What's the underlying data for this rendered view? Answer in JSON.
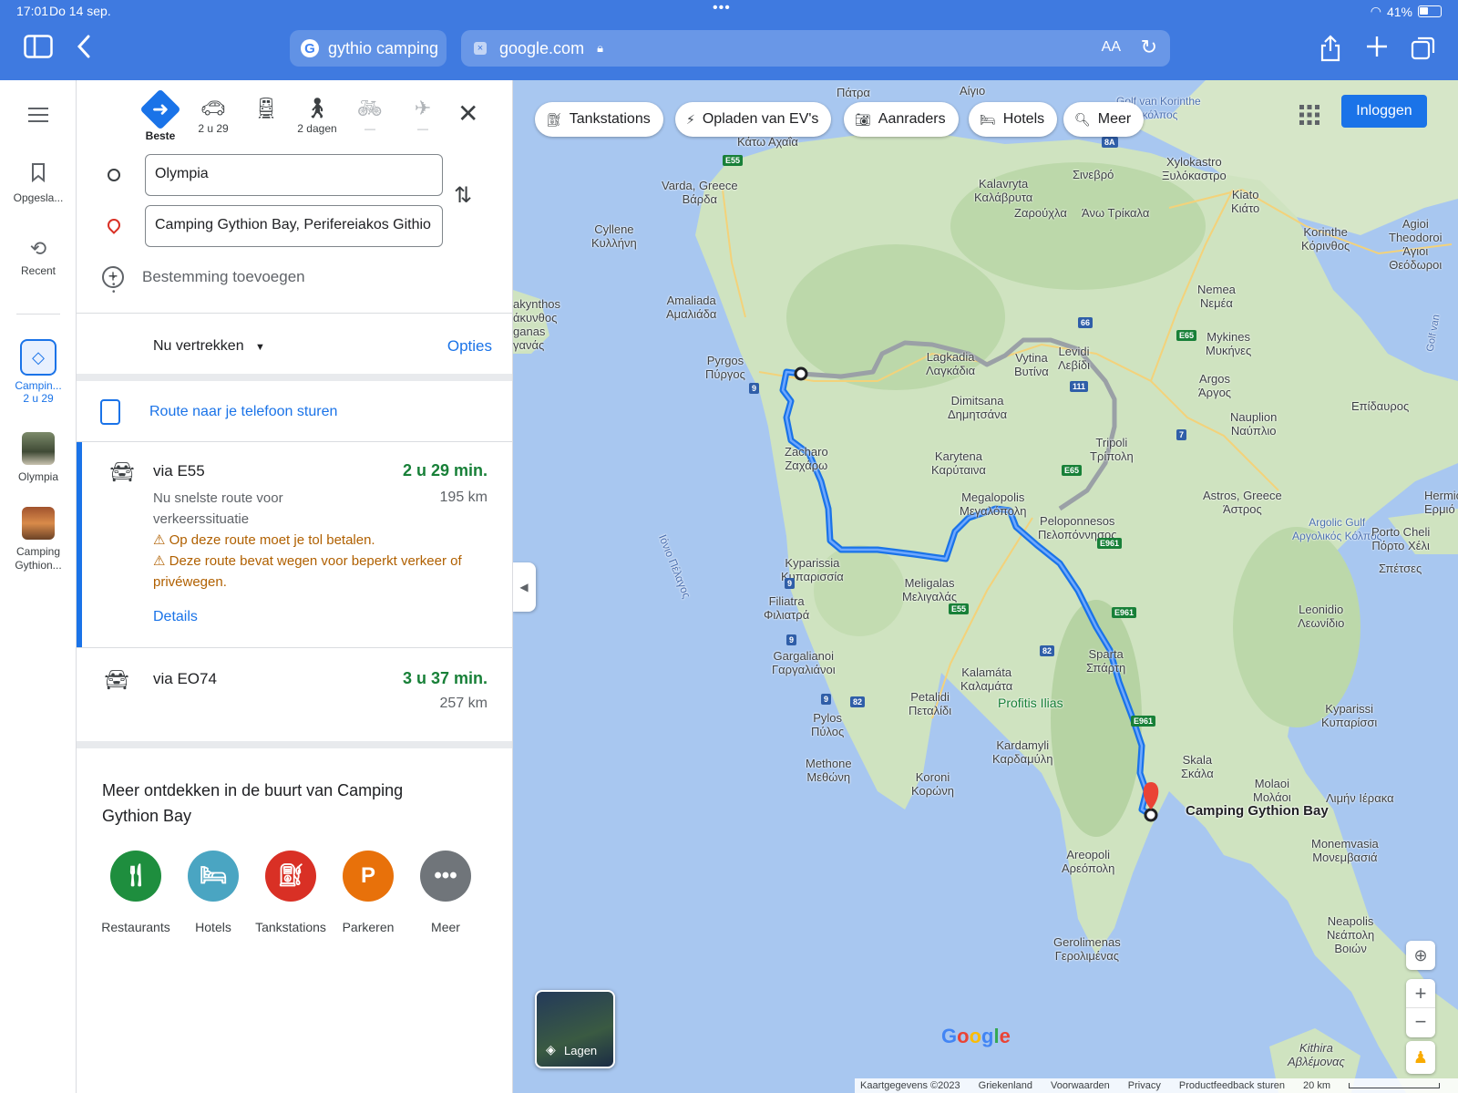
{
  "status_bar": {
    "time": "17:01",
    "date": "Do 14 sep.",
    "battery": "41%"
  },
  "browser": {
    "tab_title": "gythio camping",
    "url": "google.com",
    "text_size": "AA"
  },
  "rail": {
    "saved": "Opgesla...",
    "recent": "Recent",
    "route_item": {
      "name": "Campin...",
      "duration": "2 u 29"
    },
    "olympia": "Olympia",
    "camping": "Camping Gythion..."
  },
  "modes": [
    {
      "label": "Beste"
    },
    {
      "label": "2 u 29"
    },
    {
      "label": ""
    },
    {
      "label": "2 dagen"
    },
    {
      "label": "—"
    },
    {
      "label": "—"
    }
  ],
  "directions": {
    "origin": "Olympia",
    "destination": "Camping Gythion Bay, Perifereiakos Githio",
    "add_destination": "Bestemming toevoegen",
    "depart": "Nu vertrekken",
    "options": "Opties",
    "send_to_phone": "Route naar je telefoon sturen"
  },
  "routes": [
    {
      "via": "via E55",
      "time": "2 u 29 min.",
      "distance": "195 km",
      "description": "Nu snelste route voor verkeerssituatie",
      "warnings": [
        "Op deze route moet je tol betalen.",
        "Deze route bevat wegen voor beperkt verkeer of privéwegen."
      ],
      "details": "Details"
    },
    {
      "via": "via EO74",
      "time": "3 u 37 min.",
      "distance": "257 km"
    }
  ],
  "explore": {
    "title": "Meer ontdekken in de buurt van Camping Gythion Bay",
    "categories": [
      {
        "label": "Restaurants",
        "color": "#1e8e3e"
      },
      {
        "label": "Hotels",
        "color": "#4aa5c2"
      },
      {
        "label": "Tankstations",
        "color": "#d93025"
      },
      {
        "label": "Parkeren",
        "color": "#e8710a"
      },
      {
        "label": "Meer",
        "color": "#70757a"
      }
    ]
  },
  "map": {
    "chips": [
      "Tankstations",
      "Opladen van EV's",
      "Aanraders",
      "Hotels",
      "Meer"
    ],
    "login": "Inloggen",
    "layers": "Lagen",
    "destination_label": "Camping Gythion Bay",
    "places": {
      "pyrgos": "Pyrgos\nΠύργος",
      "zacharo": "Zacharo\nΖαχάρω",
      "kyparissia": "Kyparissia\nΚυπαρισσία",
      "filiatra": "Filiatra\nΦιλιατρά",
      "gargalianoi": "Gargalianoi\nΓαργαλιάνοι",
      "pylos": "Pylos\nΠύλος",
      "methone": "Methone\nΜεθώνη",
      "koroni": "Koroni\nΚορώνη",
      "petalidi": "Petalidi\nΠεταλίδι",
      "kalamata": "Kalamáta\nΚαλαμάτα",
      "meligalas": "Meligalas\nΜελιγαλάς",
      "megalopolis": "Megalopolis\nΜεγαλόπολη",
      "karytena": "Karytena\nΚαρύταινα",
      "dimitsana": "Dimitsana\nΔημητσάνα",
      "lagkadia": "Lagkadia\nΛαγκάδια",
      "vytina": "Vytina\nΒυτίνα",
      "levidi": "Levidi\nΛεβίδι",
      "tripoli": "Tripoli\nΤρίπολη",
      "peloponnesos": "Peloponnesos\nΠελοπόννησος",
      "sparta": "Sparta\nΣπάρτη",
      "profitis": "Profitis Ilias",
      "kardamyli": "Kardamyli\nΚαρδαμύλη",
      "areopoli": "Areopoli\nΑρεόπολη",
      "gerolimenas": "Gerolimenas\nΓερολιμένας",
      "skala": "Skala\nΣκάλα",
      "molaoi": "Molaoi\nΜολάοι",
      "limin": "Λιμήν Ιέρακα",
      "monemvasia": "Monemvasia\nΜονεμβασιά",
      "neapolis": "Neapolis\nΝεάπολη\nΒοιών",
      "kiparissi": "Kyparissi\nΚυπαρίσσι",
      "leonidio": "Leonidio\nΛεωνίδιο",
      "astros": "Astros, Greece\nΆστρος",
      "argos": "Argos\nΆργος",
      "nafplio": "Nauplion\nΝαύπλιο",
      "epidavros": "Επίδαυρος",
      "mykines": "Mykines\nΜυκήνες",
      "nemea": "Nemea\nΝεμέα",
      "korinthe": "Korinthe\nΚόρινθος",
      "agioi": "Agioi\nTheodoroi\nΆγιοι\nΘεόδωροι",
      "kiato": "Kiato\nΚιάτο",
      "xylokastro": "Xylokastro\nΞυλόκαστρο",
      "sinevro": "Σινεβρό",
      "zarouchla": "Ζαρούχλα",
      "ano_trikala": "Άνω Τρίκαλα",
      "kalavryta": "Kalavryta\nΚαλάβρυτα",
      "varda": "Varda, Greece\nΒάρδα",
      "cyllene": "Cyllene\nΚυλλήνη",
      "amaliada": "Amaliada\nΑμαλιάδα",
      "zakynthos": "akynthos\nάκυνθος\nganas\nγανάς",
      "kato_achaia": "Κάτω Αχαΐα",
      "aigio": "Αίγιο",
      "patra": "Πάτρα",
      "golf_korinthe": "Golf van Korinthe\nακός κόλπος",
      "argolic": "Argolic Gulf\nΑργολικός Κόλπος",
      "porto_cheli": "Porto Cheli\nΠόρτο Χέλι",
      "spetses": "Σπέτσες",
      "hermi": "Hermio\nΕρμιό",
      "ionio": "Ιόνιο Πέλαγος",
      "kithira": "Kithira\nΑβλέμονας",
      "golf_van": "Golf van"
    },
    "footer": [
      "Kaartgegevens ©2023",
      "Griekenland",
      "Voorwaarden",
      "Privacy",
      "Productfeedback sturen",
      "20 km"
    ]
  }
}
